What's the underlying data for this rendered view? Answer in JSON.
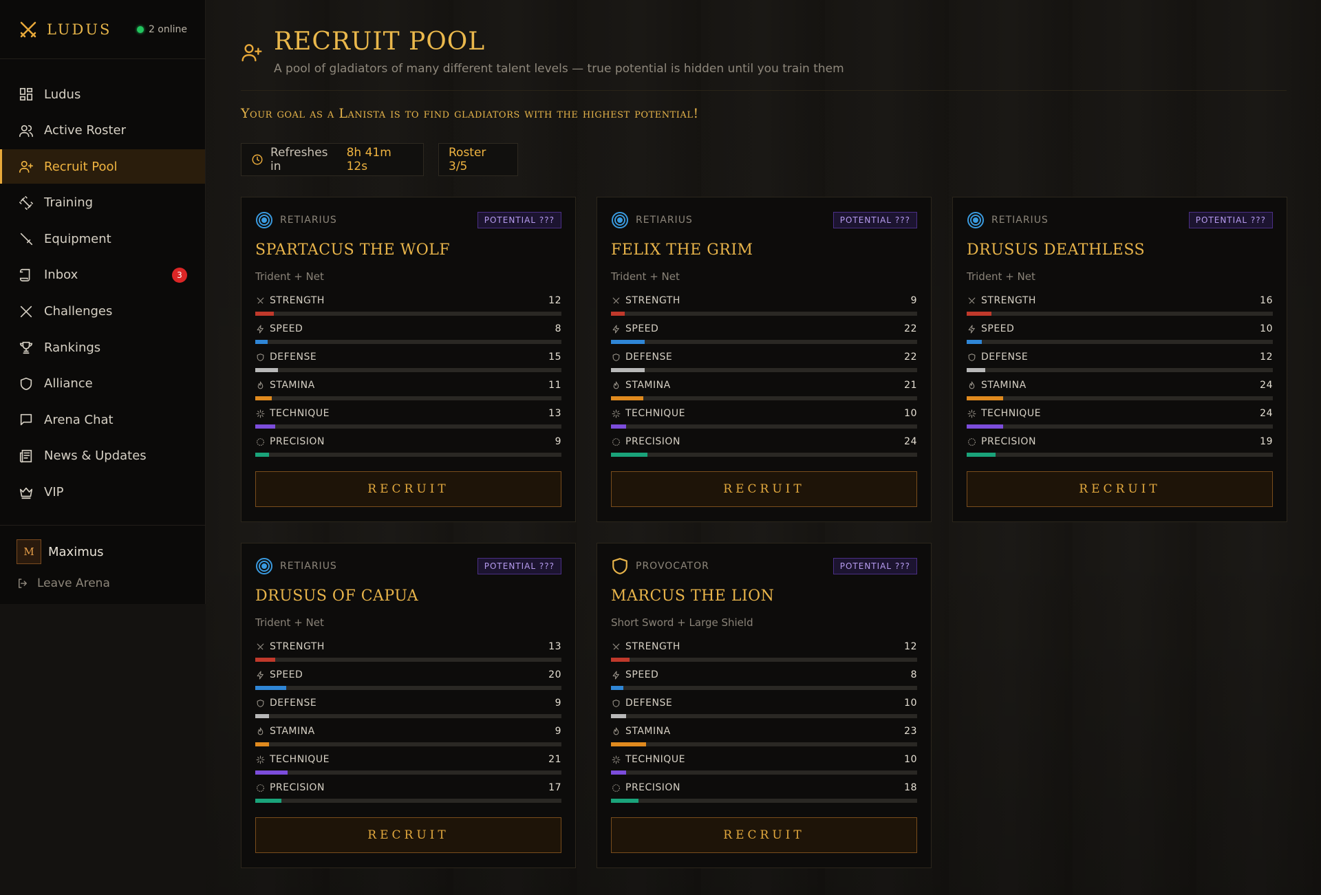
{
  "brand": {
    "name": "LUDUS",
    "online": "2 online"
  },
  "nav": [
    {
      "label": "Ludus",
      "icon": "dashboard-icon",
      "active": false
    },
    {
      "label": "Active Roster",
      "icon": "users-icon",
      "active": false
    },
    {
      "label": "Recruit Pool",
      "icon": "user-plus-icon",
      "active": true
    },
    {
      "label": "Training",
      "icon": "dumbbell-icon",
      "active": false
    },
    {
      "label": "Equipment",
      "icon": "sword-icon",
      "active": false
    },
    {
      "label": "Inbox",
      "icon": "scroll-icon",
      "active": false,
      "badge": "3"
    },
    {
      "label": "Challenges",
      "icon": "crossed-swords-icon",
      "active": false
    },
    {
      "label": "Rankings",
      "icon": "trophy-icon",
      "active": false
    },
    {
      "label": "Alliance",
      "icon": "shield-icon",
      "active": false
    },
    {
      "label": "Arena Chat",
      "icon": "chat-icon",
      "active": false
    },
    {
      "label": "News & Updates",
      "icon": "newspaper-icon",
      "active": false
    },
    {
      "label": "VIP",
      "icon": "crown-icon",
      "active": false
    }
  ],
  "user": {
    "initial": "M",
    "name": "Maximus",
    "leave": "Leave Arena"
  },
  "header": {
    "title": "RECRUIT POOL",
    "subtitle": "A pool of gladiators of many different talent levels — true potential is hidden until you train them",
    "goal": "Your goal as a Lanista is to find gladiators with the highest potential!"
  },
  "refresh": {
    "label": "Refreshes in",
    "value": "8h 41m 12s"
  },
  "roster": {
    "label": "Roster 3/5"
  },
  "stat_max": 30,
  "colors": {
    "accent": "#e8b44a",
    "strength": "#c0392b",
    "speed": "#2f86d6",
    "defense": "#b8b8b8",
    "stamina": "#e08a1e",
    "technique": "#7c4ddb",
    "precision": "#1aa37a"
  },
  "recruit_label": "RECRUIT",
  "gladiators": [
    {
      "class": "RETIARIUS",
      "class_icon": "target-icon",
      "potential": "POTENTIAL ???",
      "name": "SPARTACUS THE WOLF",
      "weapons": "Trident + Net",
      "stats": [
        {
          "key": "strength",
          "label": "STRENGTH",
          "value": 12
        },
        {
          "key": "speed",
          "label": "SPEED",
          "value": 8
        },
        {
          "key": "defense",
          "label": "DEFENSE",
          "value": 15
        },
        {
          "key": "stamina",
          "label": "STAMINA",
          "value": 11
        },
        {
          "key": "technique",
          "label": "TECHNIQUE",
          "value": 13
        },
        {
          "key": "precision",
          "label": "PRECISION",
          "value": 9
        }
      ]
    },
    {
      "class": "RETIARIUS",
      "class_icon": "target-icon",
      "potential": "POTENTIAL ???",
      "name": "FELIX THE GRIM",
      "weapons": "Trident + Net",
      "stats": [
        {
          "key": "strength",
          "label": "STRENGTH",
          "value": 9
        },
        {
          "key": "speed",
          "label": "SPEED",
          "value": 22
        },
        {
          "key": "defense",
          "label": "DEFENSE",
          "value": 22
        },
        {
          "key": "stamina",
          "label": "STAMINA",
          "value": 21
        },
        {
          "key": "technique",
          "label": "TECHNIQUE",
          "value": 10
        },
        {
          "key": "precision",
          "label": "PRECISION",
          "value": 24
        }
      ]
    },
    {
      "class": "RETIARIUS",
      "class_icon": "target-icon",
      "potential": "POTENTIAL ???",
      "name": "DRUSUS DEATHLESS",
      "weapons": "Trident + Net",
      "stats": [
        {
          "key": "strength",
          "label": "STRENGTH",
          "value": 16
        },
        {
          "key": "speed",
          "label": "SPEED",
          "value": 10
        },
        {
          "key": "defense",
          "label": "DEFENSE",
          "value": 12
        },
        {
          "key": "stamina",
          "label": "STAMINA",
          "value": 24
        },
        {
          "key": "technique",
          "label": "TECHNIQUE",
          "value": 24
        },
        {
          "key": "precision",
          "label": "PRECISION",
          "value": 19
        }
      ]
    },
    {
      "class": "RETIARIUS",
      "class_icon": "target-icon",
      "potential": "POTENTIAL ???",
      "name": "DRUSUS OF CAPUA",
      "weapons": "Trident + Net",
      "stats": [
        {
          "key": "strength",
          "label": "STRENGTH",
          "value": 13
        },
        {
          "key": "speed",
          "label": "SPEED",
          "value": 20
        },
        {
          "key": "defense",
          "label": "DEFENSE",
          "value": 9
        },
        {
          "key": "stamina",
          "label": "STAMINA",
          "value": 9
        },
        {
          "key": "technique",
          "label": "TECHNIQUE",
          "value": 21
        },
        {
          "key": "precision",
          "label": "PRECISION",
          "value": 17
        }
      ]
    },
    {
      "class": "PROVOCATOR",
      "class_icon": "shield-icon",
      "potential": "POTENTIAL ???",
      "name": "MARCUS THE LION",
      "weapons": "Short Sword + Large Shield",
      "stats": [
        {
          "key": "strength",
          "label": "STRENGTH",
          "value": 12
        },
        {
          "key": "speed",
          "label": "SPEED",
          "value": 8
        },
        {
          "key": "defense",
          "label": "DEFENSE",
          "value": 10
        },
        {
          "key": "stamina",
          "label": "STAMINA",
          "value": 23
        },
        {
          "key": "technique",
          "label": "TECHNIQUE",
          "value": 10
        },
        {
          "key": "precision",
          "label": "PRECISION",
          "value": 18
        }
      ]
    }
  ]
}
